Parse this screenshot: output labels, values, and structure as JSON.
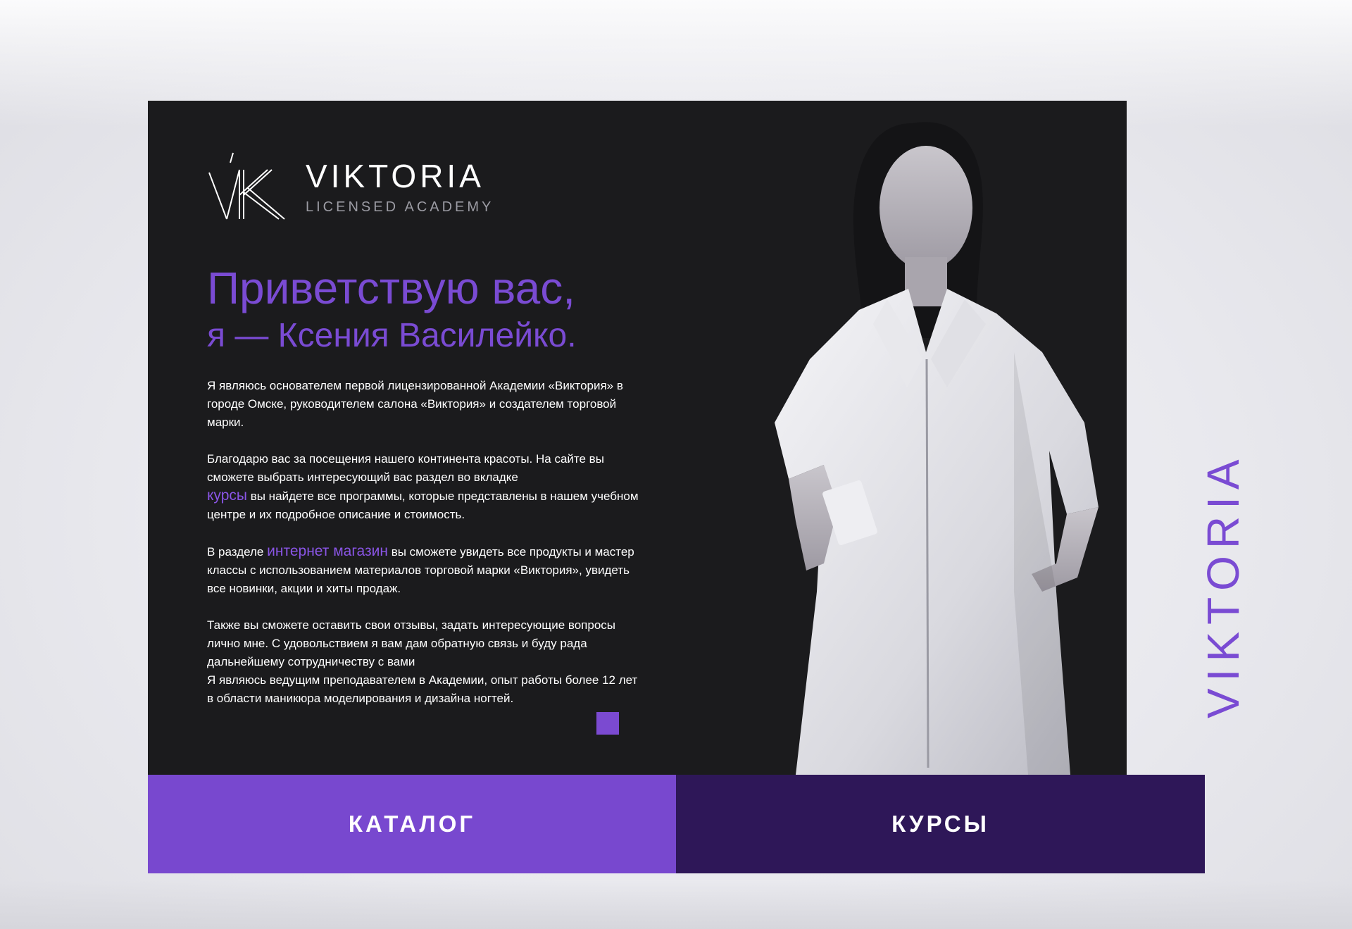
{
  "logo": {
    "mark": "VK",
    "name": "VIKTORIA",
    "subtitle": "LICENSED ACADEMY"
  },
  "greeting": {
    "line1": "Приветствую вас,",
    "line2": "я — Ксения Василейко."
  },
  "paragraphs": {
    "p1": "Я являюсь основателем первой лицензированной Академии «Виктория» в городе Омске, руководителем салона «Виктория» и создателем торговой марки.",
    "p2_a": "Благодарю вас за посещения нашего континента красоты. На сайте вы сможете выбрать интересующий вас раздел во вкладке",
    "p2_link": "курсы",
    "p2_b": "вы найдете все программы, которые представлены в нашем учебном центре и их подробное описание и стоимость.",
    "p3_a": "В разделе",
    "p3_link": "интернет магазин",
    "p3_b": "вы сможете увидеть все продукты и мастер классы с использованием материалов торговой марки «Виктория», увидеть все новинки, акции и хиты продаж.",
    "p4": "Также вы сможете оставить свои отзывы, задать интересующие вопросы лично мне. С удовольствием я вам дам обратную связь и буду рада дальнейшему сотрудничеству с вами",
    "p5": "Я являюсь ведущим преподавателем в Академии, опыт работы более 12 лет в области маникюра моделирования и дизайна ногтей."
  },
  "vertical_brand": "VIKTORIA",
  "buttons": {
    "catalog": "КАТАЛОГ",
    "courses": "КУРСЫ"
  },
  "colors": {
    "accent": "#7a4bd3",
    "dark_button": "#2e1758",
    "panel": "#1b1b1d"
  },
  "icons": {
    "logo": "vk-monogram-icon"
  }
}
